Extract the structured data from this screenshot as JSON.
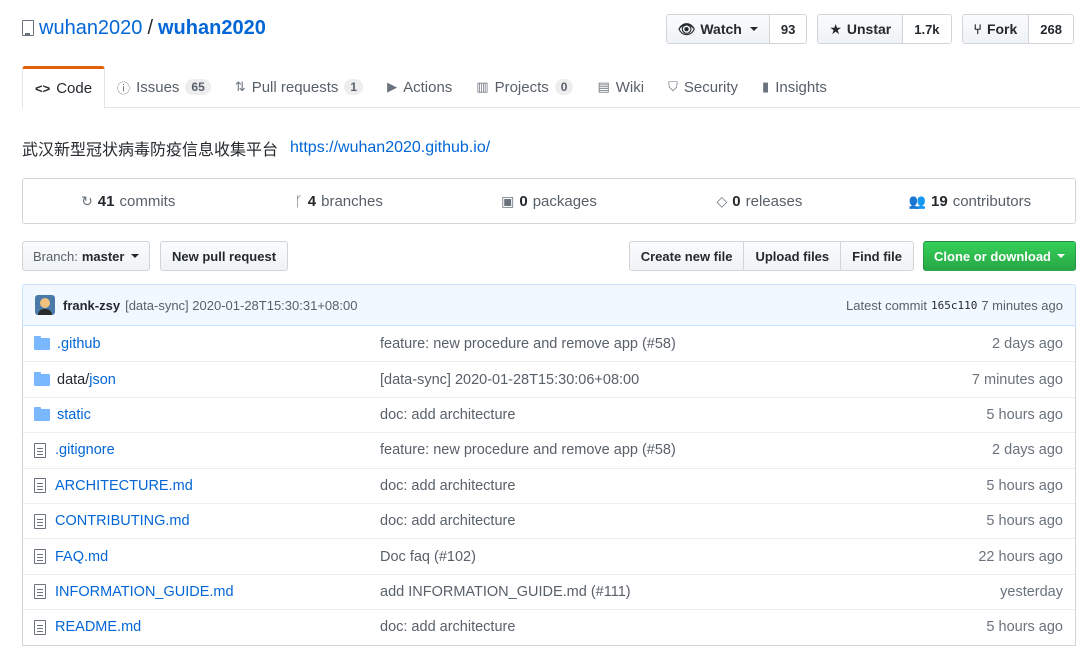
{
  "repo": {
    "owner": "wuhan2020",
    "separator": "/",
    "name": "wuhan2020"
  },
  "actions": [
    {
      "label": "Watch",
      "icon": "eye-icon",
      "count": "93",
      "caret": true
    },
    {
      "label": "Unstar",
      "icon": "star-icon",
      "count": "1.7k",
      "caret": false
    },
    {
      "label": "Fork",
      "icon": "fork-icon",
      "count": "268",
      "caret": false
    }
  ],
  "tabs": [
    {
      "label": "Code",
      "icon": "code-icon",
      "counter": "",
      "selected": true
    },
    {
      "label": "Issues",
      "icon": "issue-icon",
      "counter": "65"
    },
    {
      "label": "Pull requests",
      "icon": "pull-request-icon",
      "counter": "1"
    },
    {
      "label": "Actions",
      "icon": "play-icon",
      "counter": ""
    },
    {
      "label": "Projects",
      "icon": "project-icon",
      "counter": "0"
    },
    {
      "label": "Wiki",
      "icon": "book-icon",
      "counter": ""
    },
    {
      "label": "Security",
      "icon": "shield-icon",
      "counter": ""
    },
    {
      "label": "Insights",
      "icon": "graph-icon",
      "counter": ""
    }
  ],
  "description": {
    "text": "武汉新型冠状病毒防疫信息收集平台",
    "homepage": "https://wuhan2020.github.io/"
  },
  "summary": [
    {
      "num": "41",
      "label": "commits",
      "icon": "history-icon"
    },
    {
      "num": "4",
      "label": "branches",
      "icon": "branch-icon"
    },
    {
      "num": "0",
      "label": "packages",
      "icon": "package-icon"
    },
    {
      "num": "0",
      "label": "releases",
      "icon": "tag-icon"
    },
    {
      "num": "19",
      "label": "contributors",
      "icon": "people-icon"
    }
  ],
  "file_nav": {
    "branch_prefix": "Branch:",
    "branch": "master",
    "new_pr": "New pull request",
    "create_file": "Create new file",
    "upload": "Upload files",
    "find": "Find file",
    "clone": "Clone or download"
  },
  "commit": {
    "author": "frank-zsy",
    "message": "[data-sync] 2020-01-28T15:30:31+08:00",
    "latest_label": "Latest commit",
    "sha": "165c110",
    "age": "7 minutes ago"
  },
  "files": [
    {
      "type": "dir",
      "name": ".github",
      "name_dim": "",
      "message": "feature: new procedure and remove app (#58)",
      "age": "2 days ago"
    },
    {
      "type": "dir",
      "name": "data/",
      "name_dim": "json",
      "message": "[data-sync] 2020-01-28T15:30:06+08:00",
      "age": "7 minutes ago"
    },
    {
      "type": "dir",
      "name": "static",
      "name_dim": "",
      "message": "doc: add architecture",
      "age": "5 hours ago"
    },
    {
      "type": "file",
      "name": ".gitignore",
      "name_dim": "",
      "message": "feature: new procedure and remove app (#58)",
      "age": "2 days ago"
    },
    {
      "type": "file",
      "name": "ARCHITECTURE.md",
      "name_dim": "",
      "message": "doc: add architecture",
      "age": "5 hours ago"
    },
    {
      "type": "file",
      "name": "CONTRIBUTING.md",
      "name_dim": "",
      "message": "doc: add architecture",
      "age": "5 hours ago"
    },
    {
      "type": "file",
      "name": "FAQ.md",
      "name_dim": "",
      "message": "Doc faq (#102)",
      "age": "22 hours ago"
    },
    {
      "type": "file",
      "name": "INFORMATION_GUIDE.md",
      "name_dim": "",
      "message": "add INFORMATION_GUIDE.md (#111)",
      "age": "yesterday"
    },
    {
      "type": "file",
      "name": "README.md",
      "name_dim": "",
      "message": "doc: add architecture",
      "age": "5 hours ago"
    }
  ]
}
